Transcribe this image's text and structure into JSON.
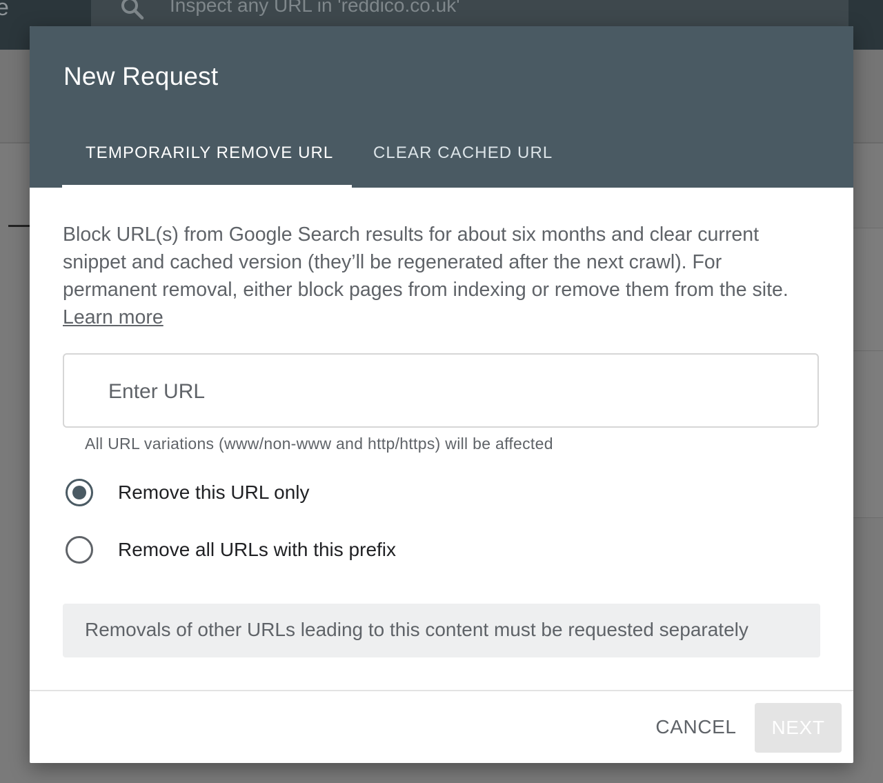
{
  "background": {
    "logo_fragment": "e",
    "search": {
      "icon": "search-icon",
      "placeholder_text": "Inspect any URL in 'reddico.co.uk'"
    }
  },
  "dialog": {
    "title": "New Request",
    "tabs": [
      {
        "label": "TEMPORARILY REMOVE URL",
        "selected": true
      },
      {
        "label": "CLEAR CACHED URL",
        "selected": false
      }
    ],
    "description": "Block URL(s) from Google Search results for about six months and clear current snippet and cached version (they’ll be regenerated after the next crawl). For permanent removal, either block pages from indexing or remove them from the site.",
    "learn_more": "Learn more",
    "url_field": {
      "placeholder": "Enter URL",
      "value": ""
    },
    "helper_text": "All URL variations (www/non-www and http/https) will be affected",
    "radio_options": [
      {
        "label": "Remove this URL only",
        "checked": true
      },
      {
        "label": "Remove all URLs with this prefix",
        "checked": false
      }
    ],
    "note": "Removals of other URLs leading to this content must be requested separately",
    "buttons": {
      "cancel": "CANCEL",
      "next": "NEXT",
      "next_disabled": true
    }
  },
  "colors": {
    "header": "#4a5a63",
    "text_secondary": "#5f6368",
    "text_primary": "#202124",
    "note_background": "#eeeff0",
    "disabled_button": "#e4e4e4"
  }
}
